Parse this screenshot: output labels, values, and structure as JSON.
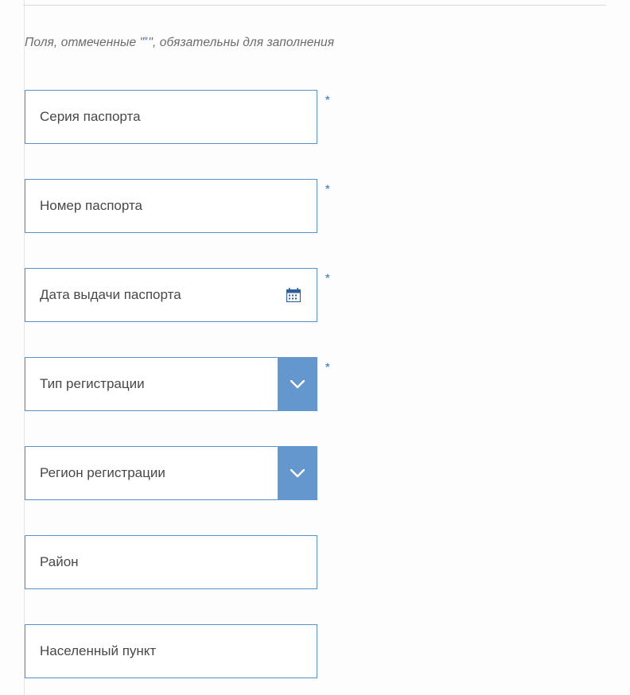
{
  "helper": {
    "before": "Поля, отмеченные \"",
    "star": "*",
    "after": "\", обязательны для заполнения"
  },
  "requiredMark": "*",
  "fields": {
    "passportSeries": {
      "label": "Серия паспорта",
      "required": true,
      "type": "text"
    },
    "passportNumber": {
      "label": "Номер паспорта",
      "required": true,
      "type": "text"
    },
    "passportIssueDate": {
      "label": "Дата выдачи паспорта",
      "required": true,
      "type": "date"
    },
    "registrationType": {
      "label": "Тип регистрации",
      "required": true,
      "type": "select"
    },
    "registrationRegion": {
      "label": "Регион регистрации",
      "required": false,
      "type": "select"
    },
    "district": {
      "label": "Район",
      "required": false,
      "type": "text"
    },
    "settlement": {
      "label": "Населенный пункт",
      "required": false,
      "type": "text"
    }
  }
}
